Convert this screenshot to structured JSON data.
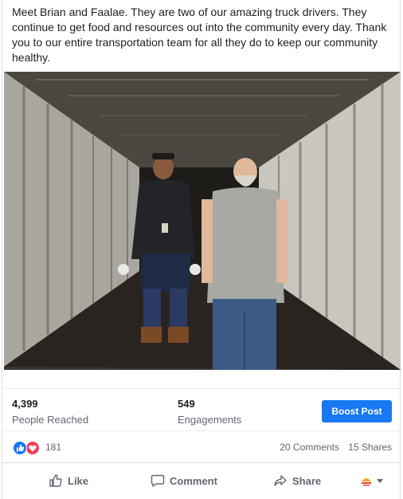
{
  "post": {
    "text": "Meet Brian and Faalae. They are two of our amazing truck drivers. They continue to get food and resources out into the community every day. Thank you to our entire transportation team for all they do to keep our community healthy."
  },
  "stats": {
    "reached_value": "4,399",
    "reached_label": "People Reached",
    "engagements_value": "549",
    "engagements_label": "Engagements",
    "boost_label": "Boost Post"
  },
  "reactions": {
    "count": "181",
    "types": [
      "like-icon",
      "love-icon"
    ],
    "comments": "20 Comments",
    "shares": "15 Shares"
  },
  "actions": {
    "like": "Like",
    "comment": "Comment",
    "share": "Share",
    "audience_icon": "page-avatar-icon"
  },
  "colors": {
    "accent": "#1877f2",
    "love": "#f33e58",
    "secondary_text": "#606770"
  }
}
